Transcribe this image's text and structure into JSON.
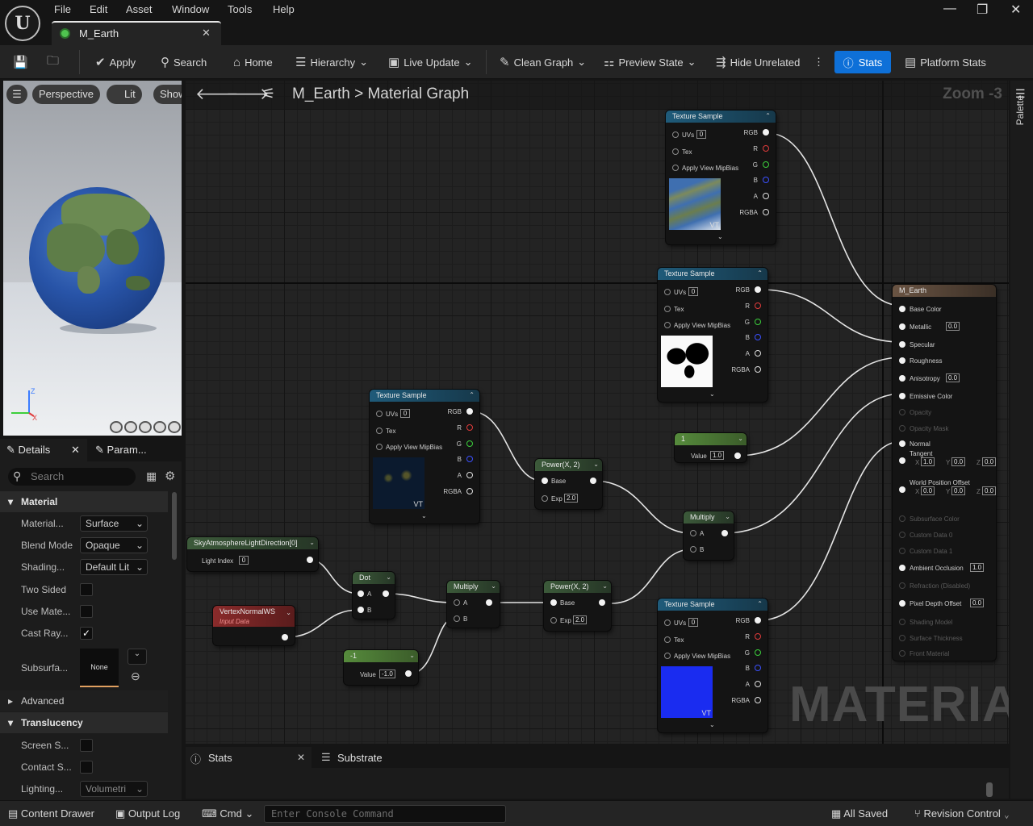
{
  "menu": [
    "File",
    "Edit",
    "Asset",
    "Window",
    "Tools",
    "Help"
  ],
  "tab": {
    "title": "M_Earth"
  },
  "toolbar": {
    "apply": "Apply",
    "search": "Search",
    "home": "Home",
    "hierarchy": "Hierarchy",
    "live_update": "Live Update",
    "clean_graph": "Clean Graph",
    "preview_state": "Preview State",
    "hide_unrelated": "Hide Unrelated",
    "stats": "Stats",
    "platform_stats": "Platform Stats"
  },
  "viewport": {
    "perspective": "Perspective",
    "lit": "Lit",
    "show": "Show"
  },
  "details": {
    "tab_details": "Details",
    "tab_params": "Param...",
    "search_placeholder": "Search",
    "sections": {
      "material": "Material",
      "advanced": "Advanced",
      "translucency": "Translucency"
    },
    "props": {
      "material_domain": {
        "label": "Material...",
        "value": "Surface"
      },
      "blend_mode": {
        "label": "Blend Mode",
        "value": "Opaque"
      },
      "shading_model": {
        "label": "Shading...",
        "value": "Default Lit"
      },
      "two_sided": {
        "label": "Two Sided",
        "checked": false
      },
      "use_material": {
        "label": "Use Mate...",
        "checked": false
      },
      "cast_ray": {
        "label": "Cast Ray...",
        "checked": true
      },
      "subsurface": {
        "label": "Subsurfa...",
        "value": "None"
      },
      "screen_s": {
        "label": "Screen S...",
        "checked": false
      },
      "contact_s": {
        "label": "Contact S...",
        "checked": false
      },
      "lighting": {
        "label": "Lighting...",
        "value": "Volumetri"
      }
    }
  },
  "graph": {
    "breadcrumb_root": "M_Earth",
    "breadcrumb_sep": ">",
    "breadcrumb_leaf": "Material Graph",
    "zoom": "Zoom -3",
    "watermark": "MATERIAL",
    "tex_pins": {
      "uvs": "UVs",
      "uvs_val": "0",
      "tex": "Tex",
      "mip": "Apply View MipBias",
      "rgb": "RGB",
      "r": "R",
      "g": "G",
      "b": "B",
      "a": "A",
      "rgba": "RGBA"
    },
    "nodes": {
      "tex1": {
        "title": "Texture Sample",
        "vt": "VT"
      },
      "tex2": {
        "title": "Texture Sample"
      },
      "tex3": {
        "title": "Texture Sample",
        "vt": "VT"
      },
      "tex4": {
        "title": "Texture Sample",
        "vt": "VT"
      },
      "power1": {
        "title": "Power(X, 2)",
        "base": "Base",
        "exp": "Exp",
        "exp_val": "2.0"
      },
      "power2": {
        "title": "Power(X, 2)",
        "base": "Base",
        "exp": "Exp",
        "exp_val": "2.0"
      },
      "multiply1": {
        "title": "Multiply",
        "a": "A",
        "b": "B"
      },
      "multiply2": {
        "title": "Multiply",
        "a": "A",
        "b": "B"
      },
      "dot": {
        "title": "Dot",
        "a": "A",
        "b": "B"
      },
      "const1": {
        "title": "1",
        "label": "Value",
        "value": "1.0"
      },
      "constneg": {
        "title": "-1",
        "label": "Value",
        "value": "-1.0"
      },
      "sky": {
        "title": "SkyAtmosphereLightDirection[0]",
        "label": "Light Index",
        "value": "0"
      },
      "vnormal": {
        "title": "VertexNormalWS",
        "subtitle": "Input Data"
      }
    },
    "result": {
      "title": "M_Earth",
      "pins": [
        {
          "label": "Base Color",
          "active": true
        },
        {
          "label": "Metallic",
          "active": true,
          "value": "0.0"
        },
        {
          "label": "Specular",
          "active": true
        },
        {
          "label": "Roughness",
          "active": true
        },
        {
          "label": "Anisotropy",
          "active": true,
          "value": "0.0"
        },
        {
          "label": "Emissive Color",
          "active": true
        },
        {
          "label": "Opacity",
          "active": false
        },
        {
          "label": "Opacity Mask",
          "active": false
        },
        {
          "label": "Normal",
          "active": true
        },
        {
          "label": "Tangent",
          "active": true,
          "xyz": [
            "1.0",
            "0.0",
            "0.0"
          ]
        },
        {
          "label": "World Position Offset",
          "active": true,
          "xyz": [
            "0.0",
            "0.0",
            "0.0"
          ]
        },
        {
          "label": "Subsurface Color",
          "active": false
        },
        {
          "label": "Custom Data 0",
          "active": false
        },
        {
          "label": "Custom Data 1",
          "active": false
        },
        {
          "label": "Ambient Occlusion",
          "active": true,
          "value": "1.0"
        },
        {
          "label": "Refraction (Disabled)",
          "active": false
        },
        {
          "label": "Pixel Depth Offset",
          "active": true,
          "value": "0.0"
        },
        {
          "label": "Shading Model",
          "active": false
        },
        {
          "label": "Surface Thickness",
          "active": false
        },
        {
          "label": "Front Material",
          "active": false
        }
      ]
    }
  },
  "bottom": {
    "stats_tab": "Stats",
    "substrate_tab": "Substrate",
    "content_drawer": "Content Drawer",
    "output_log": "Output Log",
    "cmd": "Cmd",
    "console_placeholder": "Enter Console Command",
    "all_saved": "All Saved",
    "revision_control": "Revision Control",
    "palette": "Palette"
  },
  "colors": {
    "accent": "#0e70d8",
    "texture_header": "#1f5b7a",
    "math_header": "#3c5a3a",
    "const_header": "#568b3c",
    "param_header": "#8a2b2b"
  }
}
